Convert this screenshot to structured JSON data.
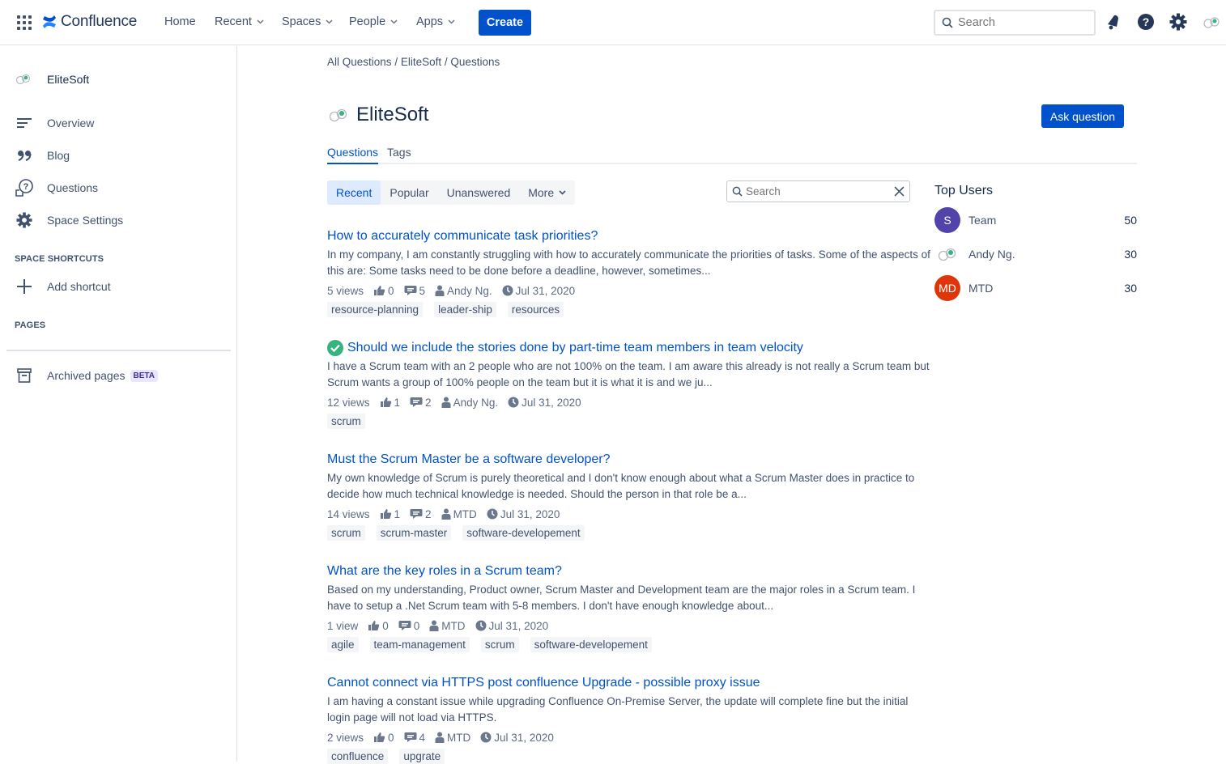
{
  "nav": {
    "logo_text": "Confluence",
    "items": [
      {
        "label": "Home",
        "has_menu": false
      },
      {
        "label": "Recent",
        "has_menu": true
      },
      {
        "label": "Spaces",
        "has_menu": true
      },
      {
        "label": "People",
        "has_menu": true
      },
      {
        "label": "Apps",
        "has_menu": true
      }
    ],
    "create_label": "Create",
    "search_placeholder": "Search",
    "icons": [
      "notifications-icon",
      "help-icon",
      "settings-icon",
      "profile-avatar"
    ]
  },
  "sidebar": {
    "space_name": "EliteSoft",
    "items": [
      {
        "label": "Overview",
        "icon": "overview-icon"
      },
      {
        "label": "Blog",
        "icon": "quote-icon"
      },
      {
        "label": "Questions",
        "icon": "questions-icon"
      },
      {
        "label": "Space Settings",
        "icon": "gear-icon"
      }
    ],
    "shortcuts_heading": "SPACE SHORTCUTS",
    "add_shortcut": "Add shortcut",
    "pages_heading": "PAGES",
    "archived_label": "Archived pages",
    "archived_badge": "BETA"
  },
  "breadcrumb": [
    "All Questions",
    "EliteSoft",
    "Questions"
  ],
  "breadcrumb_sep": "/",
  "page_title": "EliteSoft",
  "ask_button": "Ask question",
  "tabs": [
    "Questions",
    "Tags"
  ],
  "filters": [
    "Recent",
    "Popular",
    "Unanswered",
    "More"
  ],
  "question_search_placeholder": "Search",
  "questions": [
    {
      "title": "How to accurately communicate task priorities?",
      "answered": false,
      "excerpt": "In my company, I am constantly struggling with how to accurately communicate the priorities of tasks. Some of the aspects of this are: Some tasks need to be done before a deadline, however, sometimes...",
      "views": "5 views",
      "votes": "0",
      "answers": "5",
      "author": "Andy Ng.",
      "date": "Jul 31, 2020",
      "tags": [
        "resource-planning",
        "leader-ship",
        "resources"
      ]
    },
    {
      "title": "Should we include the stories done by part-time team members in team velocity",
      "answered": true,
      "excerpt": "I have a Scrum team with an 2 people who are not 100% on the team. I am aware this already is not really a Scrum team but Scrum wants a group of 100% people on the team but it is what it is and we ju...",
      "views": "12 views",
      "votes": "1",
      "answers": "2",
      "author": "Andy Ng.",
      "date": "Jul 31, 2020",
      "tags": [
        "scrum"
      ]
    },
    {
      "title": "Must the Scrum Master be a software developer?",
      "answered": false,
      "excerpt": "My own knowledge of Scrum is purely theoretical and I don't know enough about what a Scrum Master does in practice to decide how much technical knowledge is needed. Should the person in that role be a...",
      "views": "14 views",
      "votes": "1",
      "answers": "2",
      "author": "MTD",
      "date": "Jul 31, 2020",
      "tags": [
        "scrum",
        "scrum-master",
        "software-developement"
      ]
    },
    {
      "title": "What are the key roles in a Scrum team?",
      "answered": false,
      "excerpt": "Based on my understanding, Product owner, Scrum Master and Development team are the major roles in a Scrum team. I have to setup a .Net Scrum team with 5-8 members. I don't have enough knowledge about...",
      "views": "1 view",
      "votes": "0",
      "answers": "0",
      "author": "MTD",
      "date": "Jul 31, 2020",
      "tags": [
        "agile",
        "team-management",
        "scrum",
        "software-developement"
      ]
    },
    {
      "title": "Cannot connect via HTTPS post confluence Upgrade - possible proxy issue",
      "answered": false,
      "excerpt": "I am having a constant issue while upgrading Confluence On-Premise Server, the update will complete fine but the initial login page will not load via HTTPS.",
      "views": "2 views",
      "votes": "0",
      "answers": "4",
      "author": "MTD",
      "date": "Jul 31, 2020",
      "tags": [
        "confluence",
        "upgrate"
      ]
    }
  ],
  "top_users": {
    "heading": "Top Users",
    "users": [
      {
        "initials": "S",
        "name": "Team",
        "count": "50",
        "color": "#5243aa",
        "avatar": "initials"
      },
      {
        "initials": "",
        "name": "Andy Ng.",
        "count": "30",
        "color": "",
        "avatar": "space-logo"
      },
      {
        "initials": "MD",
        "name": "MTD",
        "count": "30",
        "color": "#de350b",
        "avatar": "initials"
      }
    ]
  }
}
